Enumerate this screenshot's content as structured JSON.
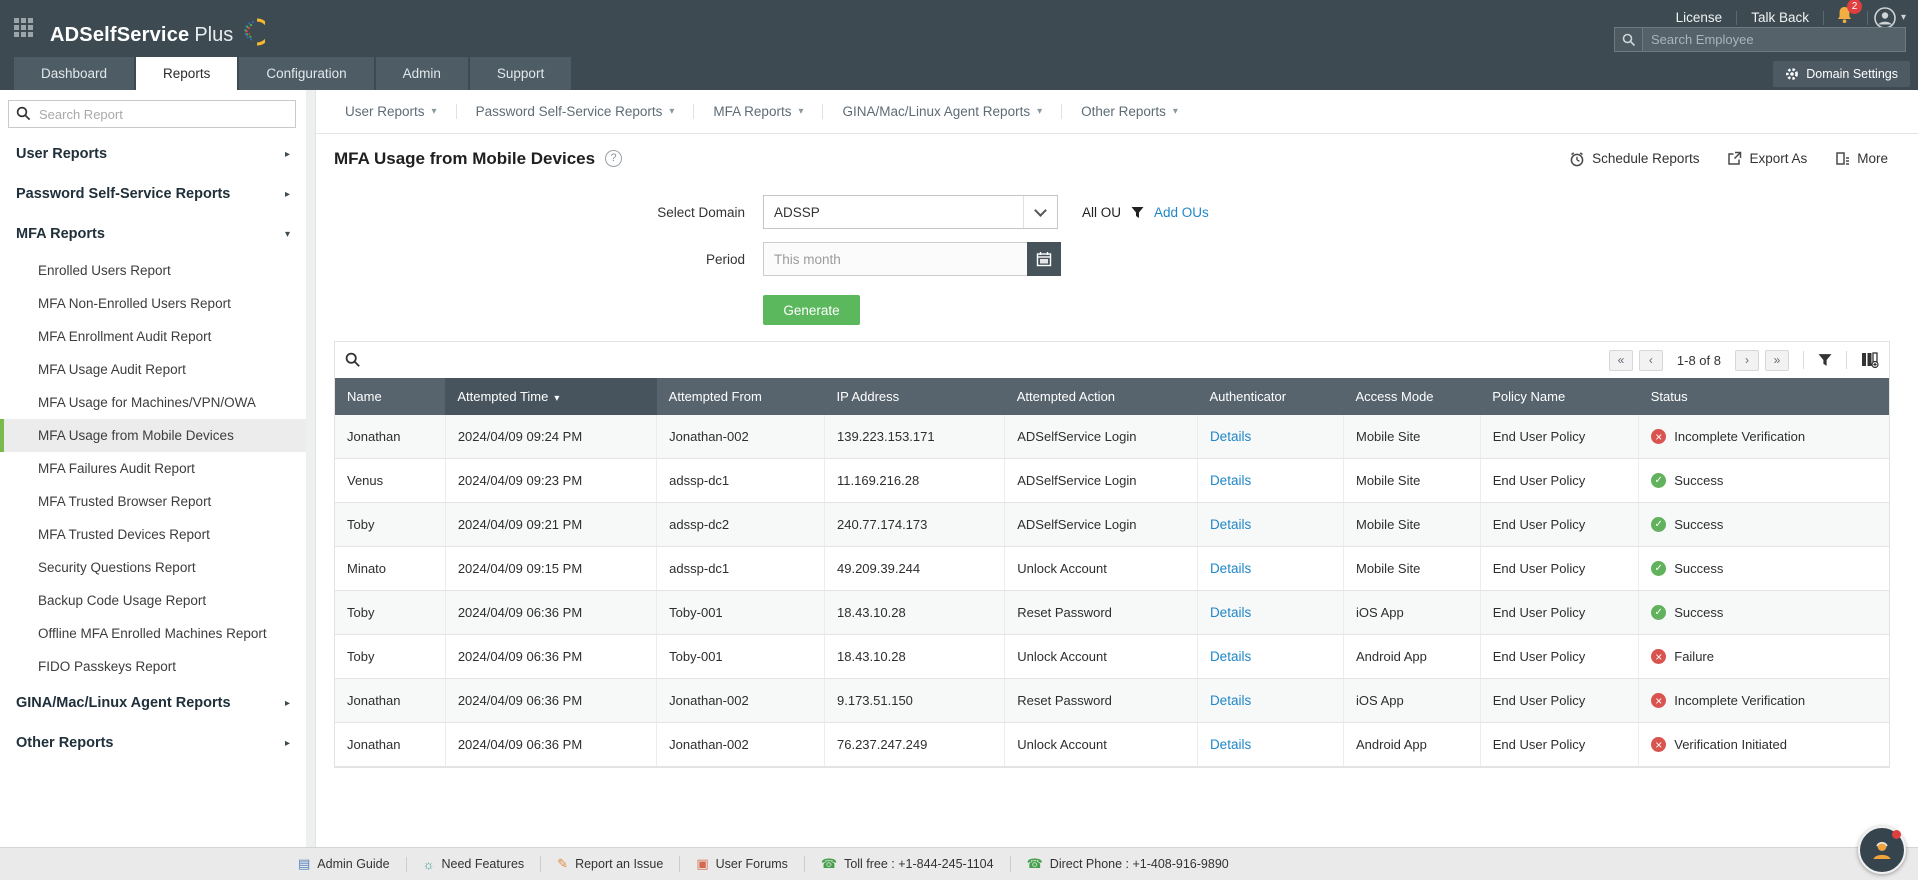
{
  "app": {
    "title_bold": "ADSelfService",
    "title_light": "Plus",
    "license_label": "License",
    "talkback_label": "Talk Back",
    "notification_count": "2",
    "employee_search_placeholder": "Search Employee",
    "domain_settings_label": "Domain Settings"
  },
  "nav_tabs": [
    {
      "label": "Dashboard",
      "cls": ""
    },
    {
      "label": "Reports",
      "cls": "active"
    },
    {
      "label": "Configuration",
      "cls": ""
    },
    {
      "label": "Admin",
      "cls": ""
    },
    {
      "label": "Support",
      "cls": ""
    }
  ],
  "sidebar": {
    "search_placeholder": "Search Report",
    "items": [
      {
        "label": "User Reports",
        "cls": "group",
        "arrow": "▸"
      },
      {
        "label": "Password Self-Service Reports",
        "cls": "group",
        "arrow": "▸"
      },
      {
        "label": "MFA Reports",
        "cls": "group",
        "arrow": "▾"
      },
      {
        "label": "Enrolled Users Report",
        "cls": "sub",
        "arrow": ""
      },
      {
        "label": "MFA Non-Enrolled Users Report",
        "cls": "sub",
        "arrow": ""
      },
      {
        "label": "MFA Enrollment Audit Report",
        "cls": "sub",
        "arrow": ""
      },
      {
        "label": "MFA Usage Audit Report",
        "cls": "sub",
        "arrow": ""
      },
      {
        "label": "MFA Usage for Machines/VPN/OWA",
        "cls": "sub",
        "arrow": ""
      },
      {
        "label": "MFA Usage from Mobile Devices",
        "cls": "sub active",
        "arrow": ""
      },
      {
        "label": "MFA Failures Audit Report",
        "cls": "sub",
        "arrow": ""
      },
      {
        "label": "MFA Trusted Browser Report",
        "cls": "sub",
        "arrow": ""
      },
      {
        "label": "MFA Trusted Devices Report",
        "cls": "sub",
        "arrow": ""
      },
      {
        "label": "Security Questions Report",
        "cls": "sub",
        "arrow": ""
      },
      {
        "label": "Backup Code Usage Report",
        "cls": "sub",
        "arrow": ""
      },
      {
        "label": "Offline MFA Enrolled Machines Report",
        "cls": "sub",
        "arrow": ""
      },
      {
        "label": "FIDO Passkeys Report",
        "cls": "sub",
        "arrow": ""
      },
      {
        "label": "GINA/Mac/Linux Agent Reports",
        "cls": "group",
        "arrow": "▸"
      },
      {
        "label": "Other Reports",
        "cls": "group",
        "arrow": "▸"
      }
    ]
  },
  "report_menu": [
    {
      "label": "User Reports"
    },
    {
      "label": "Password Self-Service Reports"
    },
    {
      "label": "MFA Reports"
    },
    {
      "label": "GINA/Mac/Linux Agent Reports"
    },
    {
      "label": "Other Reports"
    }
  ],
  "page": {
    "title": "MFA Usage from Mobile Devices",
    "help_glyph": "?",
    "schedule_label": "Schedule Reports",
    "export_label": "Export As",
    "more_label": "More"
  },
  "form": {
    "domain_label": "Select Domain",
    "domain_value": "ADSSP",
    "all_ou_label": "All OU",
    "add_ous_label": "Add OUs",
    "period_label": "Period",
    "period_placeholder": "This month",
    "generate_label": "Generate"
  },
  "pagination": {
    "first": "«",
    "prev": "‹",
    "label": "1-8 of 8",
    "next": "›",
    "last": "»"
  },
  "table": {
    "columns": [
      {
        "label": "Name",
        "cls": "",
        "arrow": ""
      },
      {
        "label": "Attempted Time",
        "cls": "sorted",
        "arrow": "▾"
      },
      {
        "label": "Attempted From",
        "cls": "",
        "arrow": ""
      },
      {
        "label": "IP Address",
        "cls": "",
        "arrow": ""
      },
      {
        "label": "Attempted Action",
        "cls": "",
        "arrow": ""
      },
      {
        "label": "Authenticator",
        "cls": "",
        "arrow": ""
      },
      {
        "label": "Access Mode",
        "cls": "",
        "arrow": ""
      },
      {
        "label": "Policy Name",
        "cls": "",
        "arrow": ""
      },
      {
        "label": "Status",
        "cls": "",
        "arrow": ""
      }
    ],
    "rows": [
      {
        "name": "Jonathan",
        "time": "2024/04/09 09:24 PM",
        "from": "Jonathan-002",
        "ip": "139.223.153.171",
        "action": "ADSelfService Login",
        "auth": "Details",
        "mode": "Mobile Site",
        "policy": "End User Policy",
        "status": "Incomplete Verification",
        "status_cls": "error"
      },
      {
        "name": "Venus",
        "time": "2024/04/09 09:23 PM",
        "from": "adssp-dc1",
        "ip": "11.169.216.28",
        "action": "ADSelfService Login",
        "auth": "Details",
        "mode": "Mobile Site",
        "policy": "End User Policy",
        "status": "Success",
        "status_cls": "ok"
      },
      {
        "name": "Toby",
        "time": "2024/04/09 09:21 PM",
        "from": "adssp-dc2",
        "ip": "240.77.174.173",
        "action": "ADSelfService Login",
        "auth": "Details",
        "mode": "Mobile Site",
        "policy": "End User Policy",
        "status": "Success",
        "status_cls": "ok"
      },
      {
        "name": "Minato",
        "time": "2024/04/09 09:15 PM",
        "from": "adssp-dc1",
        "ip": "49.209.39.244",
        "action": "Unlock Account",
        "auth": "Details",
        "mode": "Mobile Site",
        "policy": "End User Policy",
        "status": "Success",
        "status_cls": "ok"
      },
      {
        "name": "Toby",
        "time": "2024/04/09 06:36 PM",
        "from": "Toby-001",
        "ip": "18.43.10.28",
        "action": "Reset Password",
        "auth": "Details",
        "mode": "iOS App",
        "policy": "End User Policy",
        "status": "Success",
        "status_cls": "ok"
      },
      {
        "name": "Toby",
        "time": "2024/04/09 06:36 PM",
        "from": "Toby-001",
        "ip": "18.43.10.28",
        "action": "Unlock Account",
        "auth": "Details",
        "mode": "Android App",
        "policy": "End User Policy",
        "status": "Failure",
        "status_cls": "error"
      },
      {
        "name": "Jonathan",
        "time": "2024/04/09 06:36 PM",
        "from": "Jonathan-002",
        "ip": "9.173.51.150",
        "action": "Reset Password",
        "auth": "Details",
        "mode": "iOS App",
        "policy": "End User Policy",
        "status": "Incomplete Verification",
        "status_cls": "error"
      },
      {
        "name": "Jonathan",
        "time": "2024/04/09 06:36 PM",
        "from": "Jonathan-002",
        "ip": "76.237.247.249",
        "action": "Unlock Account",
        "auth": "Details",
        "mode": "Android App",
        "policy": "End User Policy",
        "status": "Verification Initiated",
        "status_cls": "error"
      }
    ]
  },
  "footer": {
    "items": [
      {
        "label": "Admin Guide",
        "icon": "admin-guide-icon",
        "glyph": "▤",
        "color": "c-blue"
      },
      {
        "label": "Need Features",
        "icon": "need-features-icon",
        "glyph": "☼",
        "color": "c-teal"
      },
      {
        "label": "Report an Issue",
        "icon": "report-issue-icon",
        "glyph": "✎",
        "color": "c-orange"
      },
      {
        "label": "User Forums",
        "icon": "user-forums-icon",
        "glyph": "▣",
        "color": "c-red"
      },
      {
        "label": "Toll free : +1-844-245-1104",
        "icon": "phone-icon",
        "glyph": "☎",
        "color": "c-green"
      },
      {
        "label": "Direct Phone : +1-408-916-9890",
        "icon": "phone-icon",
        "glyph": "☎",
        "color": "c-green"
      }
    ]
  },
  "colors": {
    "header_dark": "#3d4a51",
    "accent_green": "#5cb85c",
    "link_blue": "#1f87c9",
    "success": "#62b15c",
    "error": "#d9534f",
    "active_item_green": "#79b94e"
  }
}
